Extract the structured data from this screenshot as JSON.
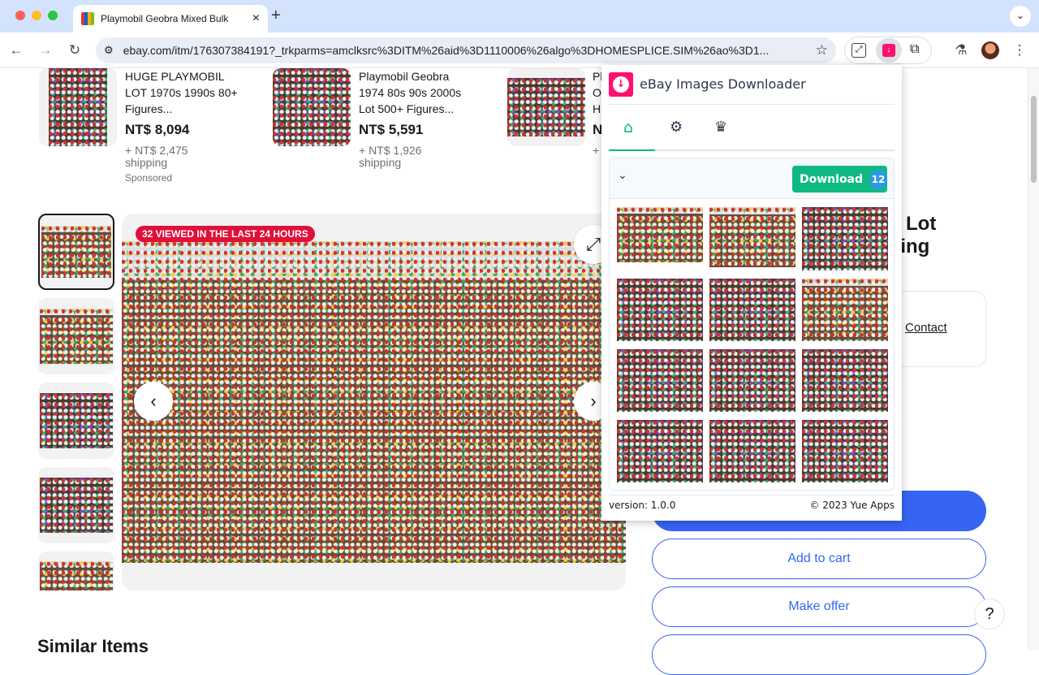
{
  "browser": {
    "tab_title": "Playmobil Geobra Mixed Bulk",
    "url": "ebay.com/itm/176307384191?_trkparms=amclksrc%3DITM%26aid%3D1110006%26algo%3DHOMESPLICE.SIM%26ao%3D1...",
    "new_tab": "+",
    "tab_close": "×"
  },
  "similar": [
    {
      "title": "HUGE PLAYMOBIL LOT 1970s 1990s 80+ Figures...",
      "price": "NT$ 8,094",
      "shipping": "+ NT$ 2,475 shipping",
      "sponsored": "Sponsored"
    },
    {
      "title": "Playmobil Geobra 1974 80s 90s 2000s Lot 500+ Figures...",
      "price": "NT$ 5,591",
      "shipping": "+ NT$ 1,926 shipping"
    },
    {
      "title": "Pl O H",
      "price": "N",
      "shipping": "+"
    }
  ],
  "listing": {
    "viewed_badge": "32 VIEWED IN THE LAST 24 HOURS",
    "title_line1": "k Lot",
    "title_line2": "king",
    "contact": "Contact",
    "add_to_cart": "Add to cart",
    "make_offer": "Make offer",
    "similar_heading": "Similar Items",
    "help": "?"
  },
  "extension": {
    "title": "eBay Images Downloader",
    "download_label": "Download",
    "count": "12",
    "version": "version: 1.0.0",
    "copyright": "© 2023 Yue Apps",
    "tabs": [
      "home-icon",
      "gear-icon",
      "crown-icon"
    ],
    "active_tab": 0,
    "colors": {
      "brand": "#ff0f6f",
      "accent": "#10b981",
      "badge": "#2b9ae6"
    }
  },
  "colors": {
    "ebay_blue": "#3665f3",
    "badge_red": "#e0103a"
  }
}
